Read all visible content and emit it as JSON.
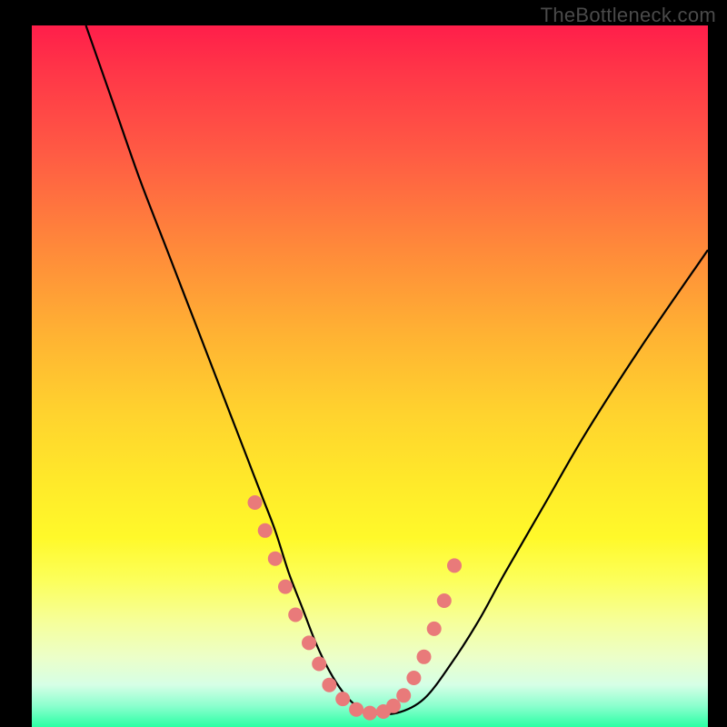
{
  "watermark": "TheBottleneck.com",
  "chart_data": {
    "type": "line",
    "title": "",
    "xlabel": "",
    "ylabel": "",
    "xlim": [
      0,
      100
    ],
    "ylim": [
      0,
      100
    ],
    "curve": {
      "name": "bottleneck-curve",
      "x": [
        8,
        12,
        16,
        20,
        24,
        28,
        30,
        32,
        34,
        36,
        38,
        40,
        42,
        44,
        46,
        48,
        50,
        54,
        58,
        62,
        66,
        70,
        76,
        82,
        90,
        100
      ],
      "y": [
        100,
        89,
        78,
        68,
        58,
        48,
        43,
        38,
        33,
        28,
        22,
        17,
        12,
        8,
        5,
        3,
        2,
        2,
        4,
        9,
        15,
        22,
        32,
        42,
        54,
        68
      ]
    },
    "markers": {
      "name": "highlight-points",
      "color": "#e97a7a",
      "x": [
        33,
        34.5,
        36,
        37.5,
        39,
        41,
        42.5,
        44,
        46,
        48,
        50,
        52,
        53.5,
        55,
        56.5,
        58,
        59.5,
        61,
        62.5
      ],
      "y": [
        32,
        28,
        24,
        20,
        16,
        12,
        9,
        6,
        4,
        2.5,
        2,
        2.2,
        3,
        4.5,
        7,
        10,
        14,
        18,
        23
      ]
    },
    "gradient_stops": [
      {
        "pos": 0,
        "color": "#ff1e4a"
      },
      {
        "pos": 18,
        "color": "#ff5a44"
      },
      {
        "pos": 44,
        "color": "#ffb233"
      },
      {
        "pos": 73,
        "color": "#fff92a"
      },
      {
        "pos": 90,
        "color": "#ecffc8"
      },
      {
        "pos": 100,
        "color": "#2bffa4"
      }
    ]
  }
}
